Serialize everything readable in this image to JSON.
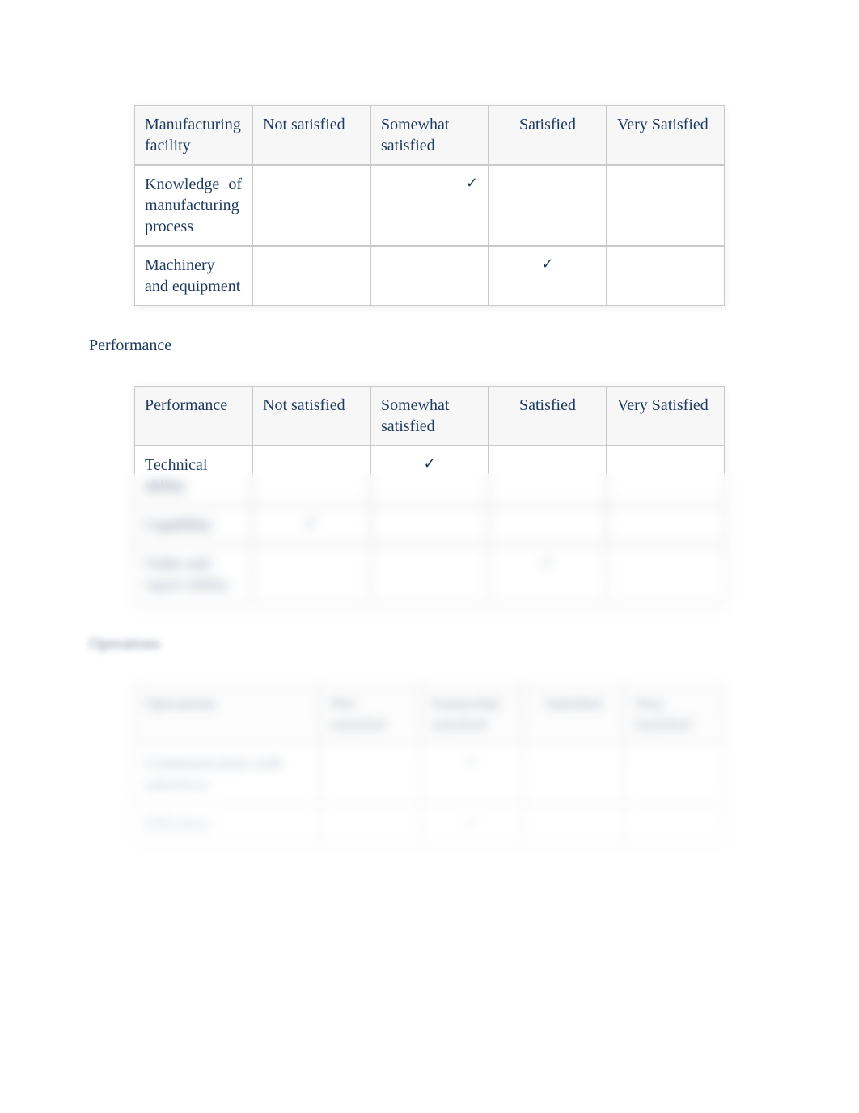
{
  "ratings": {
    "not_satisfied": "Not satisfied",
    "somewhat_satisfied": "Somewhat satisfied",
    "satisfied": "Satisfied",
    "very_satisfied": "Very Satisfied"
  },
  "check": "✓",
  "tables": {
    "manufacturing": {
      "header_label": "Manufacturing facility",
      "rows": [
        {
          "label": "Knowledge of manufacturing process",
          "checks": [
            "",
            "✓",
            "",
            ""
          ]
        },
        {
          "label": "Machinery and equipment",
          "checks": [
            "",
            "",
            "✓",
            ""
          ]
        }
      ]
    },
    "performance": {
      "heading": "Performance",
      "header_label": "Performance",
      "rows": [
        {
          "label": "Technical ability",
          "checks": [
            "",
            "✓",
            "",
            ""
          ]
        },
        {
          "label": "Capability",
          "checks": [
            "✓",
            "",
            "",
            ""
          ]
        },
        {
          "label": "Order and report ability",
          "checks": [
            "",
            "",
            "✓",
            ""
          ]
        }
      ]
    },
    "operations": {
      "heading": "Operations",
      "header_label": "Operations",
      "rows": [
        {
          "label": "Communication with salesforce",
          "checks": [
            "",
            "✓",
            "",
            ""
          ]
        },
        {
          "label": "Efficiency",
          "checks": [
            "",
            "✓",
            "",
            ""
          ]
        }
      ]
    }
  },
  "manu_header_line1": "Manufacturing",
  "manu_header_line2": "facility",
  "knowledge_line1": "Knowledge of",
  "knowledge_line2": "manufacturing process",
  "not_sat_line1": "Not",
  "not_sat_line2": "satisfied",
  "some_line1": "Some",
  "some_line2": "what",
  "some_line3": "satisfi",
  "some_line4": "ed",
  "satis_line1": "Satis",
  "satis_line2": "fied",
  "very_line1": "Very",
  "very_line2": "Satisfied"
}
